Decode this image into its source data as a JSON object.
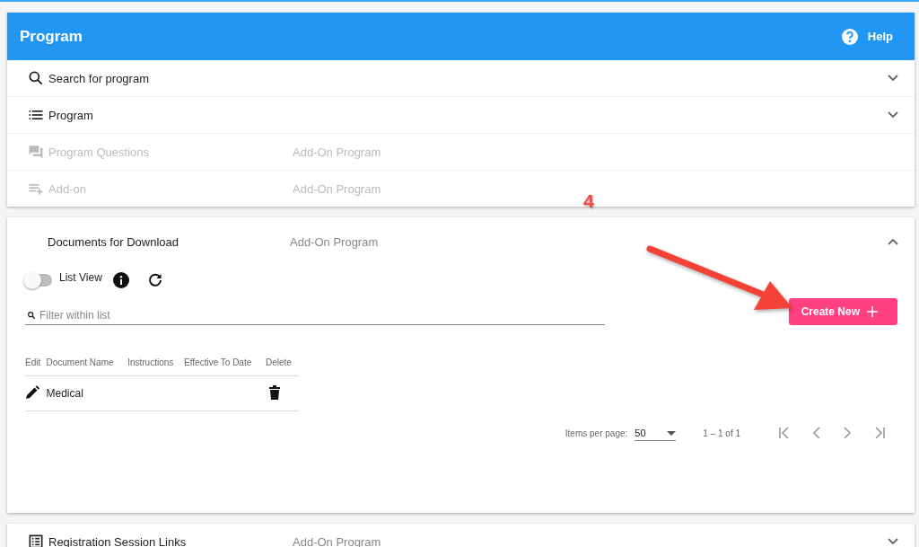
{
  "header": {
    "title": "Program",
    "help": "Help"
  },
  "panels": [
    {
      "title": "Search for program",
      "disabled": false,
      "expanded": false
    },
    {
      "title": "Program",
      "disabled": false,
      "expanded": false
    },
    {
      "title": "Program Questions",
      "description": "Add-On Program",
      "disabled": true
    },
    {
      "title": "Add-on",
      "description": "Add-On Program",
      "disabled": true
    }
  ],
  "annotation": {
    "label": "4"
  },
  "documents": {
    "title": "Documents for Download",
    "description": "Add-On Program",
    "expanded": true,
    "list_view": {
      "label": "List View",
      "on": false
    },
    "filter": {
      "placeholder": "Filter within list"
    },
    "create_button": "Create New",
    "table": {
      "columns": [
        "Edit",
        "Document Name",
        "Instructions",
        "Effective To Date",
        "Delete"
      ],
      "rows": [
        {
          "document_name": "Medical"
        }
      ]
    },
    "paginator": {
      "items_label": "Items per page:",
      "page_size": "50",
      "range": "1 – 1 of 1"
    }
  },
  "next_panel": {
    "title": "Registration Session Links",
    "description": "Add-On Program",
    "expanded": false
  }
}
